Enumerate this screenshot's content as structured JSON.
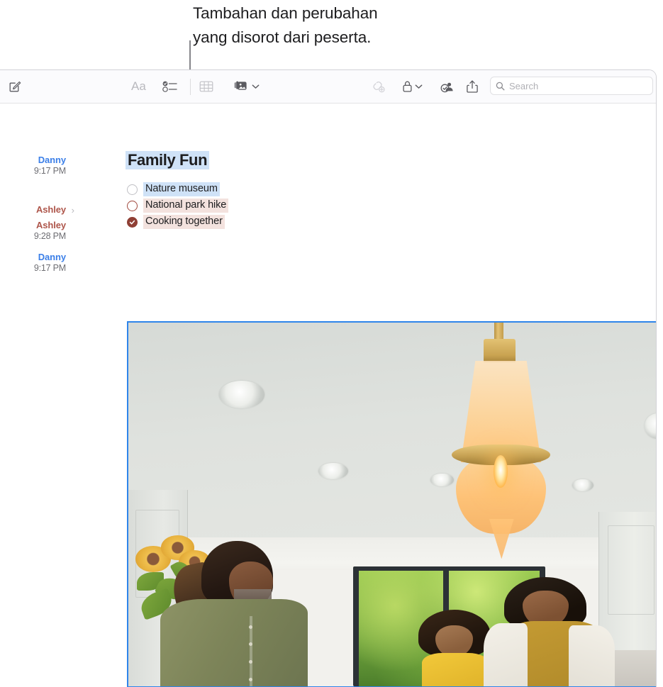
{
  "annotation": {
    "text": "Tambahan dan perubahan\nyang disorot dari peserta."
  },
  "toolbar": {
    "compose_label": "compose-icon",
    "format_label": "Aa",
    "checklist_label": "checklist-icon",
    "table_label": "table-icon",
    "media_label": "media-icon",
    "link_label": "link-icon",
    "lock_label": "lock-icon",
    "collaborate_label": "collaborate-icon",
    "share_label": "share-icon",
    "search_placeholder": "Search",
    "search_value": ""
  },
  "note": {
    "title": "Family Fun",
    "title_highlight": "blue",
    "checklist": [
      {
        "label": "Nature museum",
        "state": "unchecked",
        "circle": "gray",
        "highlight": "blue"
      },
      {
        "label": "National park hike",
        "state": "unchecked",
        "circle": "red",
        "highlight": "pink"
      },
      {
        "label": "Cooking together",
        "state": "checked",
        "circle": "fill",
        "highlight": "pink"
      }
    ],
    "attributions": [
      {
        "name": "Danny",
        "time": "9:17 PM",
        "color": "blue",
        "chevron": false
      },
      {
        "name": "Ashley",
        "time": "",
        "color": "red",
        "chevron": true
      },
      {
        "name": "Ashley",
        "time": "9:28 PM",
        "color": "red",
        "chevron": false
      },
      {
        "name": "Danny",
        "time": "9:17 PM",
        "color": "blue",
        "chevron": false
      }
    ],
    "attachment": {
      "type": "photo",
      "alt": "Family cooking together in a kitchen under a brass pendant lamp",
      "selected": true
    }
  },
  "colors": {
    "author_blue": "#3B7FE8",
    "author_red": "#AE564B",
    "highlight_blue": "#CFE2F7",
    "highlight_pink": "#F3E2DE",
    "checkbox_red": "#8F3F35",
    "selection_border": "#2F85EA",
    "callout_line": "#86868B"
  }
}
